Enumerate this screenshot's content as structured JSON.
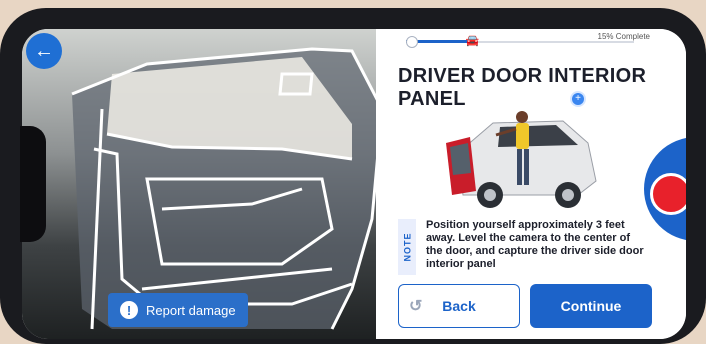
{
  "progress": {
    "label": "15% Complete",
    "value": 0.15
  },
  "step": {
    "title": "DRIVER DOOR INTERIOR PANEL"
  },
  "note": {
    "label": "NOTE",
    "text": "Position yourself approximately 3 feet away. Level the camera to the center of the door, and capture the driver side door interior panel"
  },
  "actions": {
    "back_label": "Back",
    "continue_label": "Continue",
    "report_label": "Report damage"
  },
  "icons": {
    "back": "arrow-left-icon",
    "progress_car": "car-icon",
    "report": "exclamation-icon",
    "back_action": "undo-icon",
    "capture": "record-icon"
  },
  "colors": {
    "primary": "#1c63c9",
    "capture": "#e8212b",
    "overlay_outline": "#ffffff"
  }
}
